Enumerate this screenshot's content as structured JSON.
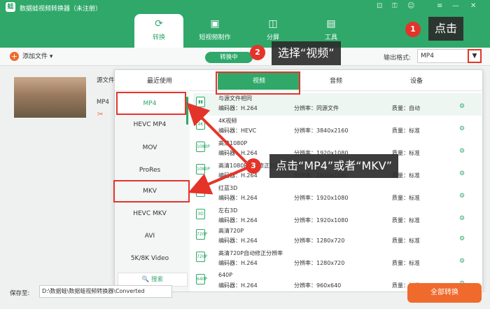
{
  "app": {
    "title": "数据蛙视频转换器（未注册）",
    "logo": "蛙"
  },
  "window_controls": [
    "cart-icon",
    "key-icon",
    "user-icon",
    "menu-icon",
    "minimize-icon",
    "close-icon"
  ],
  "nav": [
    {
      "label": "转换",
      "icon": "convert-icon",
      "active": true
    },
    {
      "label": "短视频制作",
      "icon": "image-icon",
      "active": false
    },
    {
      "label": "分屏",
      "icon": "split-icon",
      "active": false
    },
    {
      "label": "工具",
      "icon": "toolbox-icon",
      "active": false
    }
  ],
  "toolbar": {
    "add_file": "添加文件",
    "processing": "转换中",
    "output_format_label": "输出格式:",
    "output_format_value": "MP4"
  },
  "file": {
    "source_label": "源文件",
    "format": "MP4"
  },
  "format_panel": {
    "tabs": [
      "最近使用",
      "视频",
      "音频",
      "设备"
    ],
    "active_tab": "视频",
    "formats": [
      "MP4",
      "HEVC MP4",
      "MOV",
      "ProRes",
      "MKV",
      "HEVC MKV",
      "AVI",
      "5K/8K Video"
    ],
    "active_format": "MP4",
    "search": "搜索",
    "presets": [
      {
        "name": "与源文件相同",
        "encoder": "编码器：H.264",
        "resolution": "分辨率：同源文件",
        "quality": "质量：自动",
        "selected": true,
        "icon_text": "▮▮"
      },
      {
        "name": "4K视频",
        "encoder": "编码器：HEVC",
        "resolution": "分辨率：3840x2160",
        "quality": "质量：标准",
        "selected": false,
        "icon_text": "4K"
      },
      {
        "name": "高清1080P",
        "encoder": "编码器：H.264",
        "resolution": "分辨率：1920x1080",
        "quality": "质量：标准",
        "selected": false,
        "icon_text": "1080P"
      },
      {
        "name": "高清1080P自动修正分辨率",
        "encoder": "编码器：H.264",
        "resolution": "分辨率：1920x1080",
        "quality": "质量：标准",
        "selected": false,
        "icon_text": "1080P"
      },
      {
        "name": "红蓝3D",
        "encoder": "编码器：H.264",
        "resolution": "分辨率：1920x1080",
        "quality": "质量：标准",
        "selected": false,
        "icon_text": "3D"
      },
      {
        "name": "左右3D",
        "encoder": "编码器：H.264",
        "resolution": "分辨率：1920x1080",
        "quality": "质量：标准",
        "selected": false,
        "icon_text": "3D"
      },
      {
        "name": "高清720P",
        "encoder": "编码器：H.264",
        "resolution": "分辨率：1280x720",
        "quality": "质量：标准",
        "selected": false,
        "icon_text": "720P"
      },
      {
        "name": "高清720P自动修正分辨率",
        "encoder": "编码器：H.264",
        "resolution": "分辨率：1280x720",
        "quality": "质量：标准",
        "selected": false,
        "icon_text": "720P"
      },
      {
        "name": "640P",
        "encoder": "编码器：H.264",
        "resolution": "分辨率：960x640",
        "quality": "质量：标准",
        "selected": false,
        "icon_text": "640P"
      }
    ]
  },
  "bottom": {
    "save_label": "保存至:",
    "save_path": "D:\\数据蛙\\数据蛙视频转换器\\Converted",
    "convert_button": "全部转换"
  },
  "annotations": {
    "step1": {
      "num": "1",
      "text": "点击"
    },
    "step2": {
      "num": "2",
      "text": "选择“视频”"
    },
    "step3": {
      "num": "3",
      "text": "点击“MP4”或者“MKV”"
    }
  },
  "colors": {
    "brand": "#2fa86a",
    "accent": "#ef6a2c",
    "annotation_red": "#e4342a"
  }
}
